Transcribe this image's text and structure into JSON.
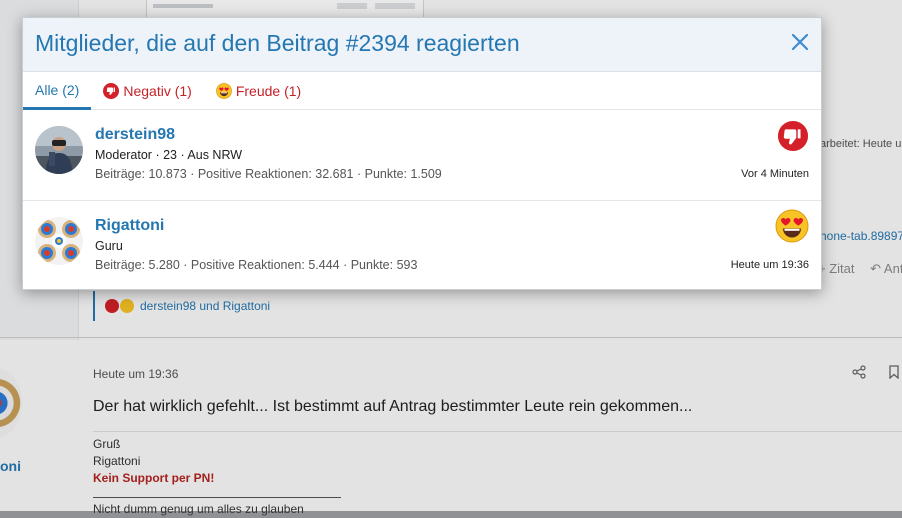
{
  "modal": {
    "title": "Mitglieder, die auf den Beitrag #2394 reagierten",
    "tabs": [
      {
        "label": "Alle (2)"
      },
      {
        "label": "Negativ (1)"
      },
      {
        "label": "Freude (1)"
      }
    ],
    "members": [
      {
        "name": "derstein98",
        "title": "Moderator · 23 · Aus NRW",
        "stats": "Beiträge: 10.873 · Positive Reaktionen: 32.681 · Punkte: 1.509",
        "time": "Vor 4 Minuten",
        "reaction_icon": "thumbs-down-icon"
      },
      {
        "name": "Rigattoni",
        "title": "Guru",
        "stats": "Beiträge: 5.280 · Positive Reaktionen: 5.444 · Punkte: 593",
        "time": "Heute um 19:36",
        "reaction_icon": "heart-eyes-icon"
      }
    ]
  },
  "background": {
    "edited_text": "arbeitet: Heute u",
    "link_text": "hone-tab.89897",
    "action_quote": "+ Zitat",
    "action_reply": "↶ Ant",
    "reaction_summary": "derstein98 und Rigattoni",
    "post": {
      "author": "oni",
      "time": "Heute um 19:36",
      "body": "Der hat wirklich gefehlt... Ist bestimmt auf Antrag bestimmter Leute rein gekommen...",
      "sig_line1": "Gruß",
      "sig_line2": "Rigattoni",
      "sig_support": "Kein Support per PN!",
      "sig_quote": "Nicht dumm genug um alles zu glauben"
    }
  },
  "colors": {
    "accent": "#2577b1",
    "negative": "#d42028",
    "joy": "#f7c325"
  }
}
